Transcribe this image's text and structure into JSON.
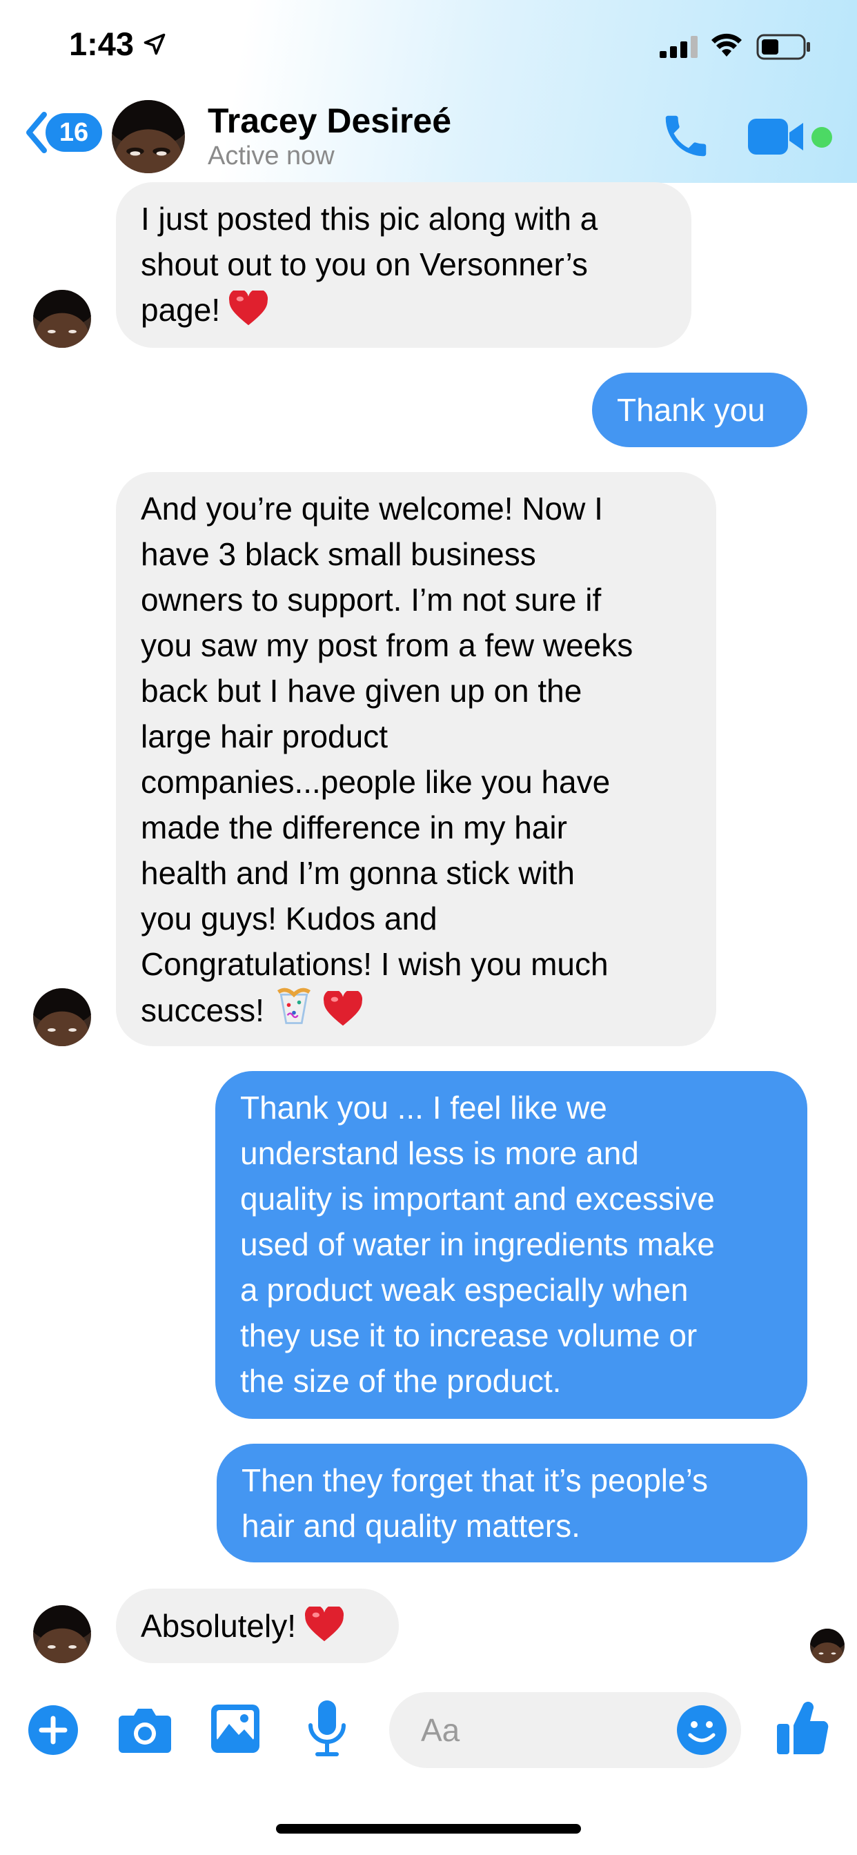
{
  "status_bar": {
    "time": "1:43"
  },
  "header": {
    "back_count": "16",
    "contact_name": "Tracey Desireé",
    "contact_status": "Active now",
    "accent_color": "#1d8cf0",
    "online_color": "#4cd964"
  },
  "messages": [
    {
      "sender": "contact",
      "lines": [
        "I just posted this pic along with a",
        "shout out to you on Versonner’s",
        "page!"
      ],
      "emoji": "heart"
    },
    {
      "sender": "me",
      "lines": [
        "Thank you"
      ]
    },
    {
      "sender": "contact",
      "lines": [
        "And you’re quite welcome!  Now I",
        "have 3 black small business",
        "owners to support. I’m not sure if",
        "you saw my post from a few weeks",
        "back but I have given up on the",
        "large hair product",
        "companies...people like you have",
        "made the difference in my hair",
        "health and I’m gonna stick with",
        "you guys! Kudos and",
        "Congratulations!  I wish you much",
        "success!"
      ],
      "emoji": "confetti-heart"
    },
    {
      "sender": "me",
      "lines": [
        "Thank you ... I feel like we",
        "understand less is more and",
        "quality is important and excessive",
        "used of water in ingredients make",
        "a product weak especially when",
        "they use it to increase volume or",
        "the size of the product."
      ]
    },
    {
      "sender": "me",
      "lines": [
        "Then they forget that it’s people’s",
        "hair and quality matters."
      ]
    },
    {
      "sender": "contact",
      "lines": [
        "Absolutely!"
      ],
      "emoji": "heart"
    }
  ],
  "composer": {
    "placeholder": "Aa",
    "icons": [
      "plus-icon",
      "camera-icon",
      "photo-icon",
      "microphone-icon",
      "emoji-icon",
      "thumbs-up-icon"
    ]
  },
  "colors": {
    "incoming_bubble": "#f0f0f0",
    "outgoing_bubble": "#4496f2",
    "messenger_blue": "#1d8cf0"
  }
}
